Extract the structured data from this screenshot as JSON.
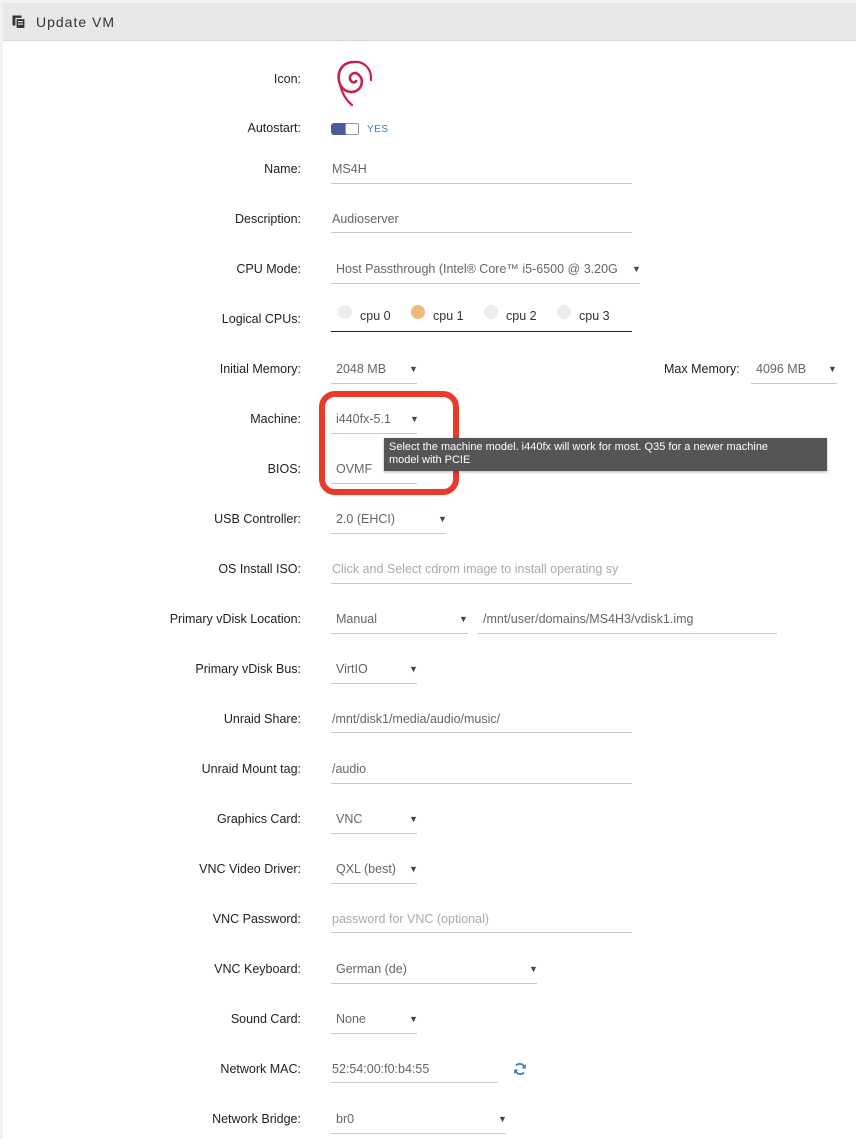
{
  "header": {
    "title": "Update VM",
    "icon": "copy-icon"
  },
  "form": {
    "icon_label": "Icon:",
    "icon_name": "debian-swirl-icon",
    "autostart_label": "Autostart:",
    "autostart_value": "YES",
    "name_label": "Name:",
    "name_value": "MS4H",
    "description_label": "Description:",
    "description_value": "Audioserver",
    "cpu_mode_label": "CPU Mode:",
    "cpu_mode_value": "Host Passthrough (Intel® Core™ i5-6500 @ 3.20G",
    "logical_cpus_label": "Logical CPUs:",
    "cpus": [
      {
        "label": "cpu 0",
        "checked": false
      },
      {
        "label": "cpu 1",
        "checked": true
      },
      {
        "label": "cpu 2",
        "checked": false
      },
      {
        "label": "cpu 3",
        "checked": false
      }
    ],
    "initial_memory_label": "Initial Memory:",
    "initial_memory_value": "2048 MB",
    "max_memory_label": "Max Memory:",
    "max_memory_value": "4096 MB",
    "machine_label": "Machine:",
    "machine_value": "i440fx-5.1",
    "machine_tooltip_line1": "Select the machine model.  i440fx will work for most.  Q35 for a newer machine",
    "machine_tooltip_line2": "model with PCIE",
    "bios_label": "BIOS:",
    "bios_value": "OVMF",
    "usb_label": "USB Controller:",
    "usb_value": "2.0 (EHCI)",
    "os_iso_label": "OS Install ISO:",
    "os_iso_placeholder": "Click and Select cdrom image to install operating sy",
    "vdisk_location_label": "Primary vDisk Location:",
    "vdisk_location_value": "Manual",
    "vdisk_path_value": "/mnt/user/domains/MS4H3/vdisk1.img",
    "vdisk_bus_label": "Primary vDisk Bus:",
    "vdisk_bus_value": "VirtIO",
    "unraid_share_label": "Unraid Share:",
    "unraid_share_value": "/mnt/disk1/media/audio/music/",
    "mount_tag_label": "Unraid Mount tag:",
    "mount_tag_value": "/audio",
    "graphics_label": "Graphics Card:",
    "graphics_value": "VNC",
    "vnc_driver_label": "VNC Video Driver:",
    "vnc_driver_value": "QXL (best)",
    "vnc_password_label": "VNC Password:",
    "vnc_password_placeholder": "password for VNC (optional)",
    "vnc_keyboard_label": "VNC Keyboard:",
    "vnc_keyboard_value": "German (de)",
    "sound_label": "Sound Card:",
    "sound_value": "None",
    "mac_label": "Network MAC:",
    "mac_value": "52:54:00:f0:b4:55",
    "bridge_label": "Network Bridge:",
    "bridge_value": "br0"
  },
  "colors": {
    "highlight": "#e8392a",
    "toggle": "#4a5a9a",
    "checked_cpu": "#efb97c",
    "link": "#3a7fc0"
  }
}
